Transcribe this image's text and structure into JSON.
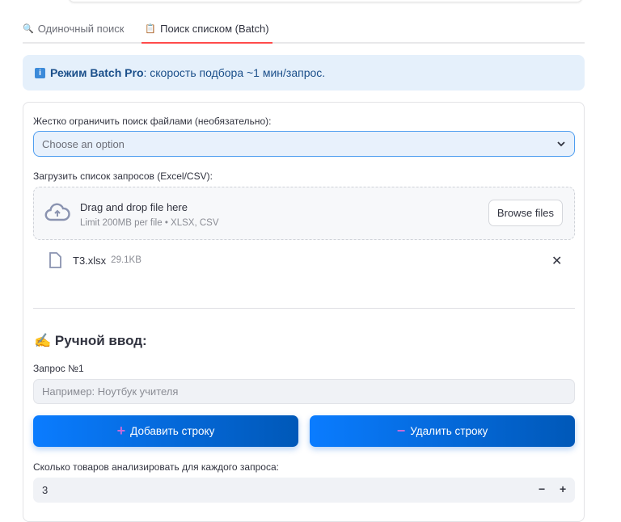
{
  "tabs": [
    {
      "icon": "🔍",
      "label": "Одиночный поиск"
    },
    {
      "icon": "📋",
      "label": "Поиск списком (Batch)"
    }
  ],
  "info": {
    "bold": "Режим Batch Pro",
    "text": ": скорость подбора ~1 мин/запрос."
  },
  "files_filter": {
    "label": "Жестко ограничить поиск файлами (необязательно):",
    "placeholder": "Choose an option"
  },
  "upload": {
    "label": "Загрузить список запросов (Excel/CSV):",
    "title": "Drag and drop file here",
    "hint": "Limit 200MB per file • XLSX, CSV",
    "browse": "Browse files",
    "file_name": "T3.xlsx",
    "file_size": "29.1KB"
  },
  "manual": {
    "heading": "Ручной ввод:",
    "heading_icon": "✍️",
    "query_label": "Запрос №1",
    "query_placeholder": "Например: Ноутбук учителя",
    "add_label": "Добавить строку",
    "remove_label": "Удалить строку",
    "add_icon": "+",
    "remove_icon": "−"
  },
  "count": {
    "label": "Сколько товаров анализировать для каждого запроса:",
    "value": "3",
    "minus": "−",
    "plus": "+"
  }
}
